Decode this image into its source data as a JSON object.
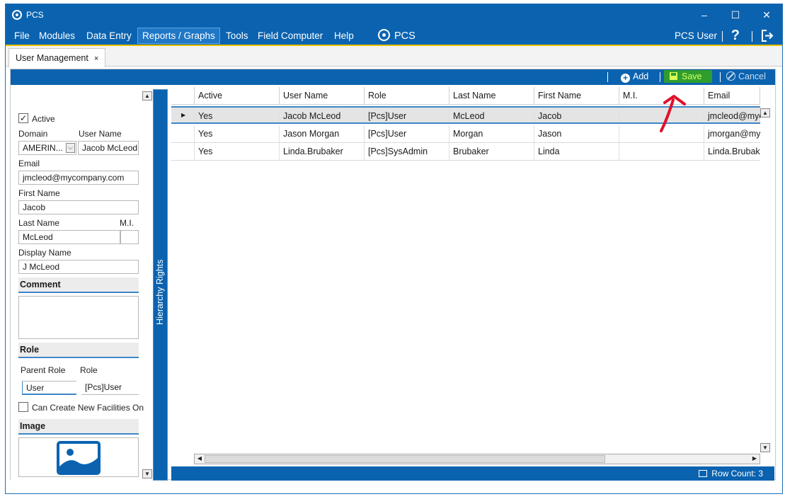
{
  "window": {
    "title": "PCS",
    "minimize": "–",
    "maximize": "☐",
    "close": "✕"
  },
  "menu": {
    "items": [
      "File",
      "Modules",
      "Data Entry",
      "Reports / Graphs",
      "Tools",
      "Field Computer",
      "Help"
    ],
    "brand": "PCS",
    "user": "PCS User",
    "help": "?"
  },
  "tabs": [
    {
      "label": "User Management",
      "close": "×"
    }
  ],
  "toolbar": {
    "add": "Add",
    "save": "Save",
    "cancel": "Cancel"
  },
  "form": {
    "active_label": "Active",
    "active_checked": true,
    "domain_label": "Domain",
    "domain_value": "AMERIN...",
    "username_label": "User Name",
    "username_value": "Jacob McLeod",
    "email_label": "Email",
    "email_value": "jmcleod@mycompany.com",
    "firstname_label": "First Name",
    "firstname_value": "Jacob",
    "lastname_label": "Last Name",
    "lastname_value": "McLeod",
    "mi_label": "M.I.",
    "mi_value": "",
    "displayname_label": "Display Name",
    "displayname_value": "J McLeod",
    "comment_section": "Comment",
    "comment_value": "",
    "role_section": "Role",
    "parent_role_label": "Parent Role",
    "role_label": "Role",
    "parent_role_value": "User",
    "role_value": "[Pcs]User",
    "can_create_label": "Can Create New Facilities On",
    "image_section": "Image"
  },
  "hierarchy_panel": {
    "label": "Hierarchy Rights"
  },
  "grid": {
    "columns": [
      "Active",
      "User Name",
      "Role",
      "Last Name",
      "First Name",
      "M.I.",
      "Email"
    ],
    "rows": [
      [
        "Yes",
        "Jacob McLeod",
        "[Pcs]User",
        "McLeod",
        "Jacob",
        "",
        "jmcleod@myc"
      ],
      [
        "Yes",
        "Jason Morgan",
        "[Pcs]User",
        "Morgan",
        "Jason",
        "",
        "jmorgan@my"
      ],
      [
        "Yes",
        "Linda.Brubaker",
        "[Pcs]SysAdmin",
        "Brubaker",
        "Linda",
        "",
        "Linda.Brubake"
      ]
    ],
    "selected_row": 0
  },
  "status": {
    "row_count": "Row Count: 3"
  },
  "colors": {
    "brand_blue": "#0b63b0",
    "save_green": "#2f9e2f",
    "highlight": "#d8ff5a",
    "annotation_red": "#e0102a"
  }
}
